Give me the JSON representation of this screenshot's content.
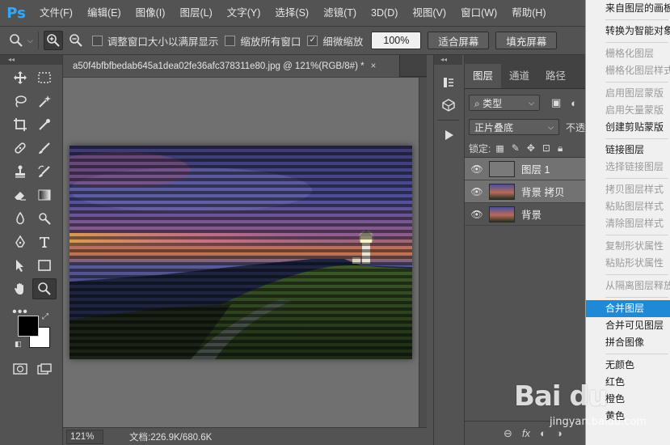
{
  "app": {
    "logo": "Ps",
    "menu": [
      "文件(F)",
      "编辑(E)",
      "图像(I)",
      "图层(L)",
      "文字(Y)",
      "选择(S)",
      "滤镜(T)",
      "3D(D)",
      "视图(V)",
      "窗口(W)",
      "帮助(H)"
    ]
  },
  "options": {
    "resize_windows": "调整窗口大小以满屏显示",
    "zoom_all": "缩放所有窗口",
    "scrubby_zoom": "细微缩放",
    "zoom_value": "100%",
    "fit_screen": "适合屏幕",
    "fill_screen": "填充屏幕"
  },
  "document": {
    "tab_title": "a50f4bfbfbedab645a1dea02fe36afc378311e80.jpg @ 121%(RGB/8#) *",
    "close": "×",
    "zoom": "121%",
    "doc_info": "文档:226.9K/680.6K"
  },
  "layers_panel": {
    "tabs": [
      "图层",
      "通道",
      "路径"
    ],
    "filter_kind": "类型",
    "blend_mode": "正片叠底",
    "opacity_label": "不透",
    "lock_label": "锁定:",
    "layers": [
      {
        "name": "图层 1",
        "selected": true
      },
      {
        "name": "背景 拷贝",
        "selected": true
      },
      {
        "name": "背景",
        "selected": false
      }
    ],
    "footer": [
      "⊖",
      "fx",
      "◐",
      "◑"
    ]
  },
  "context_menu": {
    "items": [
      {
        "label": "来自图层的画板...",
        "state": "enabled"
      },
      {
        "sep": true
      },
      {
        "label": "转换为智能对象",
        "state": "enabled"
      },
      {
        "sep": true
      },
      {
        "label": "栅格化图层",
        "state": "disabled"
      },
      {
        "label": "栅格化图层样式",
        "state": "disabled"
      },
      {
        "sep": true
      },
      {
        "label": "启用图层蒙版",
        "state": "disabled"
      },
      {
        "label": "启用矢量蒙版",
        "state": "disabled"
      },
      {
        "label": "创建剪贴蒙版",
        "state": "enabled"
      },
      {
        "sep": true
      },
      {
        "label": "链接图层",
        "state": "enabled"
      },
      {
        "label": "选择链接图层",
        "state": "disabled"
      },
      {
        "sep": true
      },
      {
        "label": "拷贝图层样式",
        "state": "disabled"
      },
      {
        "label": "粘贴图层样式",
        "state": "disabled"
      },
      {
        "label": "清除图层样式",
        "state": "disabled"
      },
      {
        "sep": true
      },
      {
        "label": "复制形状属性",
        "state": "disabled"
      },
      {
        "label": "粘贴形状属性",
        "state": "disabled"
      },
      {
        "sep": true
      },
      {
        "label": "从隔离图层释放",
        "state": "disabled"
      },
      {
        "sep": true
      },
      {
        "label": "合并图层",
        "state": "highlight"
      },
      {
        "label": "合并可见图层",
        "state": "enabled"
      },
      {
        "label": "拼合图像",
        "state": "enabled"
      },
      {
        "sep": true
      },
      {
        "label": "无颜色",
        "state": "enabled"
      },
      {
        "label": "红色",
        "state": "enabled"
      },
      {
        "label": "橙色",
        "state": "enabled"
      },
      {
        "label": "黄色",
        "state": "enabled"
      }
    ]
  },
  "watermark": {
    "text": "Bai du",
    "sub": "jingyan.baidu.com"
  },
  "colors": {
    "accent": "#31a8ff",
    "highlight": "#1e8ad6",
    "panel": "#535353"
  }
}
